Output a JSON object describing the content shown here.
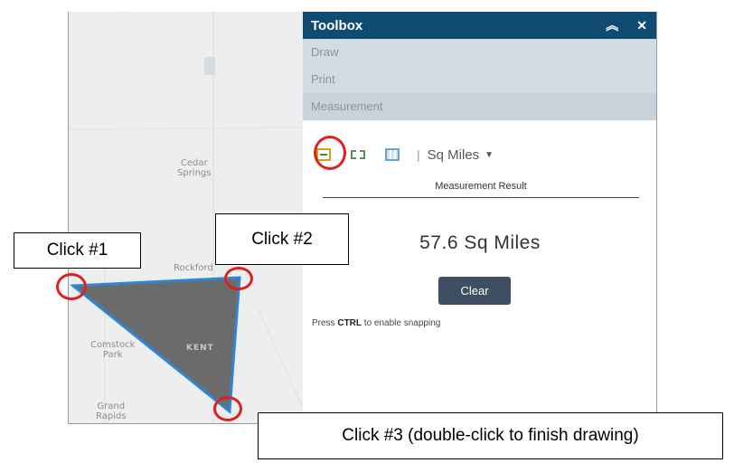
{
  "panel": {
    "title": "Toolbox",
    "collapse_icon": "double-chevron-up-icon",
    "close_icon": "close-icon",
    "nav": [
      "Draw",
      "Print",
      "Measurement"
    ],
    "tools": [
      "area-measure-icon",
      "distance-measure-icon",
      "location-measure-icon"
    ],
    "unit": "Sq Miles",
    "result_label": "Measurement Result",
    "result_value": "57.6 Sq Miles",
    "clear_label": "Clear",
    "hint_prefix": "Press",
    "hint_key": "CTRL",
    "hint_suffix": "to enable snapping"
  },
  "map": {
    "places": [
      "Cedar\nSprings",
      "Rockford",
      "Comstock\nPark",
      "Grand\nRapids",
      "KENT"
    ],
    "polygon_fill": "#6b6b6b",
    "polygon_stroke": "#2f86d6"
  },
  "callouts": {
    "click1": "Click #1",
    "click2": "Click #2",
    "click3": "Click #3 (double-click to finish drawing)"
  },
  "colors": {
    "header": "#0f4b73",
    "nav": "#d3dbe1",
    "highlight_ring": "#e01e1e",
    "button": "#3e4f63"
  }
}
